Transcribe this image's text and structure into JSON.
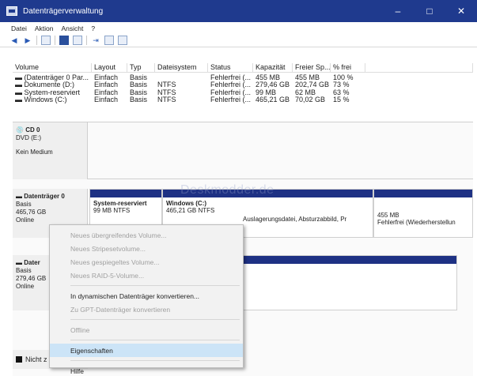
{
  "window": {
    "title": "Datenträgerverwaltung",
    "min": "–",
    "max": "□",
    "close": "✕",
    "icon": "disk-management-icon"
  },
  "menu": [
    "Datei",
    "Aktion",
    "Ansicht",
    "?"
  ],
  "toolbar": [
    "back-icon",
    "forward-icon",
    "list-view-icon",
    "help-icon",
    "properties-icon",
    "connect-icon",
    "refresh-icon",
    "new-icon"
  ],
  "volumes": {
    "headers": [
      "Volume",
      "Layout",
      "Typ",
      "Dateisystem",
      "Status",
      "Kapazität",
      "Freier Sp...",
      "% frei"
    ],
    "rows": [
      [
        "(Datenträger 0 Par...",
        "Einfach",
        "Basis",
        "",
        "Fehlerfrei (...",
        "455 MB",
        "455 MB",
        "100 %"
      ],
      [
        "Dokumente (D:)",
        "Einfach",
        "Basis",
        "NTFS",
        "Fehlerfrei (...",
        "279,46 GB",
        "202,74 GB",
        "73 %"
      ],
      [
        "System-reserviert",
        "Einfach",
        "Basis",
        "NTFS",
        "Fehlerfrei (...",
        "99 MB",
        "62 MB",
        "63 %"
      ],
      [
        "Windows (C:)",
        "Einfach",
        "Basis",
        "NTFS",
        "Fehlerfrei (...",
        "465,21 GB",
        "70,02 GB",
        "15 %"
      ]
    ]
  },
  "cd": {
    "name": "CD 0",
    "drive": "DVD (E:)",
    "status": "Kein Medium"
  },
  "disk0": {
    "name": "Datenträger 0",
    "type": "Basis",
    "size": "465,76 GB",
    "state": "Online",
    "partitions": {
      "system": {
        "name": "System-reserviert",
        "detail": "99 MB NTFS"
      },
      "windows": {
        "name": "Windows (C:)",
        "detail": "465,21 GB NTFS",
        "status": "Auslagerungsdatei, Absturzabbild, Pr"
      },
      "recovery": {
        "size": "455 MB",
        "status": "Fehlerfrei (Wiederherstellun"
      }
    }
  },
  "disk1": {
    "name": "Dater",
    "type": "Basis",
    "size": "279,46 GB",
    "state": "Online"
  },
  "unallocated": {
    "label": "Nicht z",
    "color": "#111111"
  },
  "watermark": "Deskmodder.de",
  "context_menu": {
    "items": [
      {
        "label": "Neues übergreifendes Volume...",
        "enabled": false
      },
      {
        "label": "Neues Stripesetvolume...",
        "enabled": false
      },
      {
        "label": "Neues gespiegeltes Volume...",
        "enabled": false
      },
      {
        "label": "Neues RAID-5-Volume...",
        "enabled": false
      },
      {
        "label": "In dynamischen Datenträger konvertieren...",
        "enabled": true
      },
      {
        "label": "Zu GPT-Datenträger konvertieren",
        "enabled": false
      },
      {
        "label": "Offline",
        "enabled": false
      },
      {
        "label": "Eigenschaften",
        "enabled": true,
        "highlighted": true
      },
      {
        "label": "Hilfe",
        "enabled": true
      }
    ]
  },
  "colors": {
    "title_bar": "#1f3a8e",
    "partition_bar": "#1e3184",
    "highlight": "#cce4f7"
  }
}
